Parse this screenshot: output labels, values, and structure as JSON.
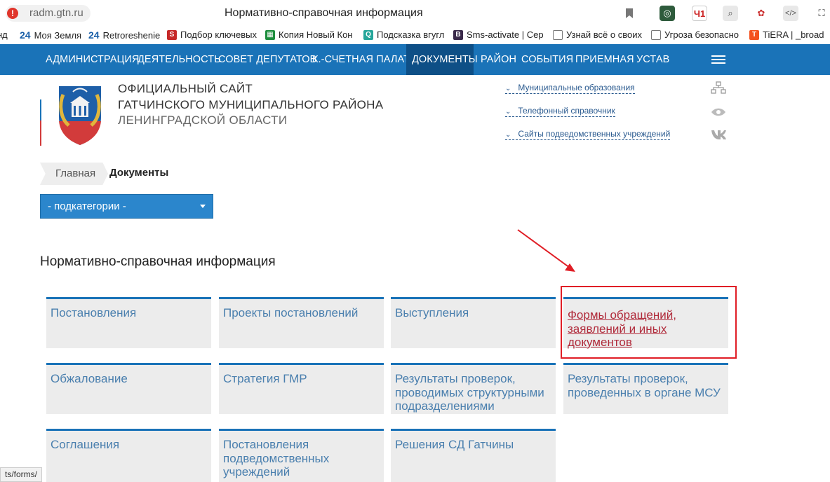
{
  "browser": {
    "url": "radm.gtn.ru",
    "page_title": "Нормативно-справочная информация",
    "bookmarks": [
      {
        "label": "нд",
        "icon": "none"
      },
      {
        "label": "Моя Земля",
        "icon": "24-icon"
      },
      {
        "label": "Retroreshenie",
        "icon": "24-icon"
      },
      {
        "label": "Подбор ключевых",
        "icon": "s-icon"
      },
      {
        "label": "Копия Новый Кон",
        "icon": "sheets-icon"
      },
      {
        "label": "Подсказка вгугл",
        "icon": "search-icon"
      },
      {
        "label": "Sms-activate | Сер",
        "icon": "b-icon"
      },
      {
        "label": "Узнай всё о своих",
        "icon": "page-icon"
      },
      {
        "label": "Угроза безопасно",
        "icon": "page-icon"
      },
      {
        "label": "TiERA | _broad",
        "icon": "tiera-icon"
      }
    ],
    "status_text": "ts/forms/"
  },
  "nav": {
    "items": [
      {
        "label": "АДМИНИСТРАЦИЯ"
      },
      {
        "label": "ДЕЯТЕЛЬНОСТЬ"
      },
      {
        "label": "СОВЕТ ДЕПУТАТОВ"
      },
      {
        "label": "К.-СЧЕТНАЯ ПАЛАТА"
      },
      {
        "label": "ДОКУМЕНТЫ"
      },
      {
        "label": "РАЙОН"
      },
      {
        "label": "СОБЫТИЯ"
      },
      {
        "label": "ПРИЕМНАЯ"
      },
      {
        "label": "УСТАВ"
      }
    ]
  },
  "header": {
    "title_line1": "ОФИЦИАЛЬНЫЙ САЙТ",
    "title_line2": "ГАТЧИНСКОГО МУНИЦИПАЛЬНОГО РАЙОНА",
    "title_line3": "ЛЕНИНГРАДСКОЙ ОБЛАСТИ",
    "links": [
      {
        "label": "Муниципальные образования",
        "icon": "sitemap-icon"
      },
      {
        "label": "Телефонный справочник",
        "icon": "eye-icon"
      },
      {
        "label": "Сайты подведомственных учреждений",
        "icon": "vk-icon"
      }
    ]
  },
  "breadcrumb": {
    "home": "Главная",
    "current": "Документы"
  },
  "filter": {
    "selected": "- подкатегории -"
  },
  "section": {
    "title": "Нормативно-справочная информация",
    "tiles": [
      {
        "label": "Постановления"
      },
      {
        "label": "Проекты постановлений"
      },
      {
        "label": "Выступления"
      },
      {
        "label": "Формы обращений, заявлений и иных документов"
      },
      {
        "label": "Обжалование"
      },
      {
        "label": "Стратегия ГМР"
      },
      {
        "label": "Результаты проверок, проводимых структурными подразделениями"
      },
      {
        "label": "Результаты проверок, проведенных в органе МСУ"
      },
      {
        "label": "Соглашения"
      },
      {
        "label": "Постановления подведомственных учреждений"
      },
      {
        "label": "Решения СД Гатчины"
      }
    ]
  },
  "colors": {
    "nav_bg": "#1a73b8",
    "nav_active": "#0e4f86",
    "tile_bg": "#ececec",
    "tile_text": "#4a7fae",
    "highlight": "#e01e26",
    "annotation_arrow": "#e01e26"
  }
}
